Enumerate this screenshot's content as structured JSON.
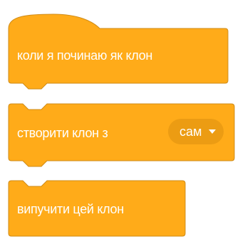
{
  "colors": {
    "block_fill": "#ffab19",
    "block_stroke": "#cf8b17",
    "dropdown_fill": "#ec9c13",
    "text": "#ffffff"
  },
  "blocks": [
    {
      "type": "hat",
      "label": "коли я починаю як клон"
    },
    {
      "type": "command",
      "label": "створити клон з",
      "dropdown": {
        "value": "сам",
        "icon": "chevron-down-icon"
      }
    },
    {
      "type": "cap",
      "label": "випучити цей клон"
    }
  ]
}
